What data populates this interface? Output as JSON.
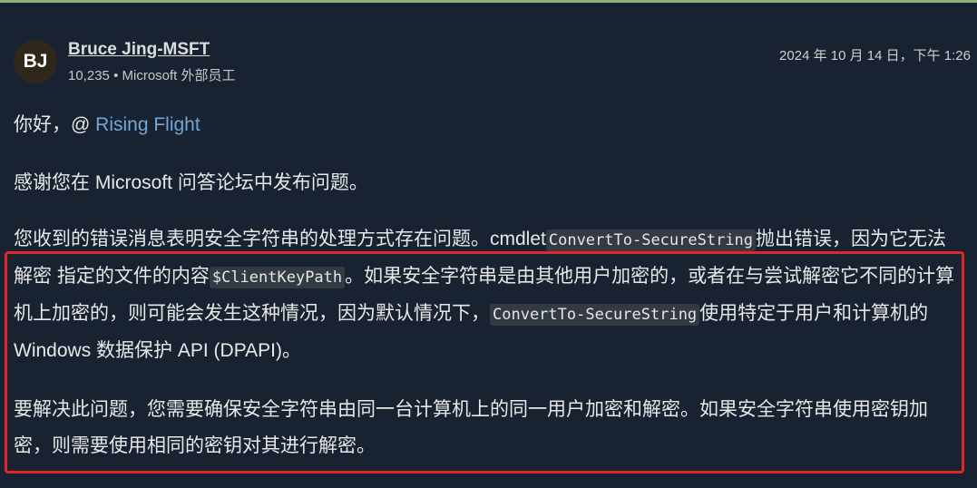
{
  "author": {
    "initials": "BJ",
    "name": "Bruce Jing-MSFT",
    "reputation": "10,235",
    "separator": "•",
    "role": "Microsoft 外部员工"
  },
  "post": {
    "timestamp": "2024 年 10 月 14 日，下午 1:26",
    "greeting_prefix": "你好，@ ",
    "mention": "Rising Flight",
    "thanks": "感谢您在 Microsoft 问答论坛中发布问题。",
    "explain_1": "您收到的错误消息表明安全字符串的处理方式存在问题。cmdlet",
    "code_cmdlet": "ConvertTo-SecureString",
    "explain_2": "抛出错误，因为它无法解密 指定的文件的内容",
    "code_path": "$ClientKeyPath",
    "explain_3": "。如果安全字符串是由其他用户加密的，或者在与尝试解密它不同的计算机上加密的，则可能会发生这种情况，因为默认情况下，",
    "code_cmdlet_2": "ConvertTo-SecureString",
    "explain_4": "使用特定于用户和计算机的 Windows 数据保护 API (DPAPI)。",
    "solution": "要解决此问题，您需要确保安全字符串由同一台计算机上的同一用户加密和解密。如果安全字符串使用密钥加密，则需要使用相同的密钥对其进行解密。"
  },
  "colors": {
    "background": "#182231",
    "link": "#74a7d9",
    "highlight_border": "#e0262a",
    "top_accent": "#8db37a"
  }
}
